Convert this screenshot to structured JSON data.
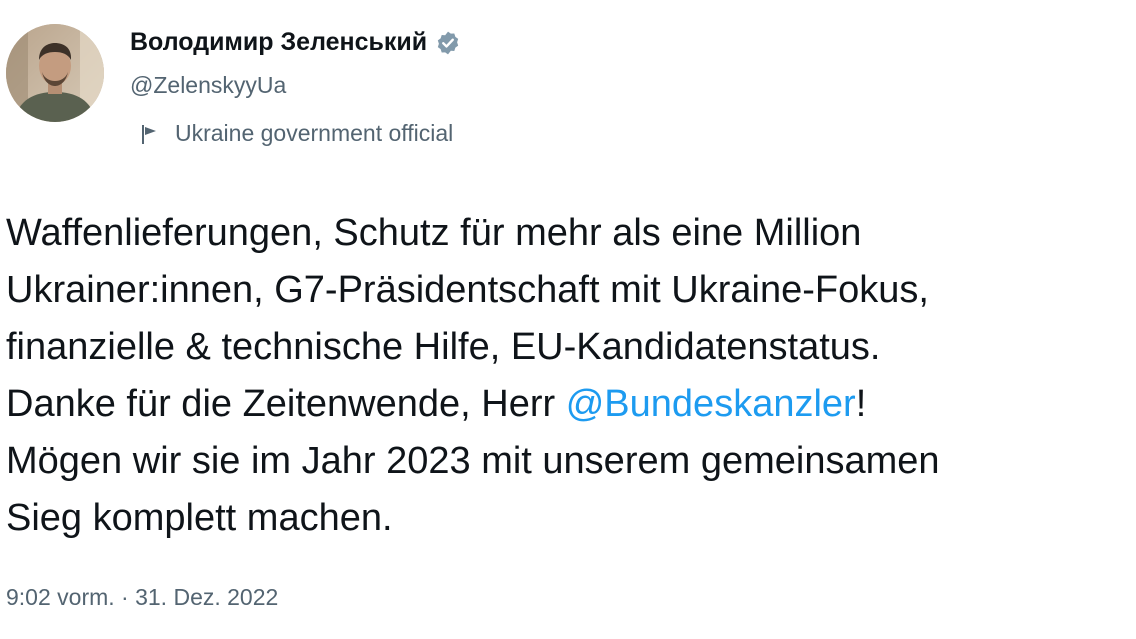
{
  "author": {
    "display_name": "Володимир Зеленський",
    "handle": "@ZelenskyyUa",
    "verified": true,
    "label": "Ukraine government official",
    "avatar_icon": "profile-photo",
    "verified_color": "#829aab"
  },
  "tweet": {
    "line1": "Waffenlieferungen, Schutz für mehr als eine Million",
    "line2": "Ukrainer:innen, G7-Präsidentschaft mit Ukraine-Fokus,",
    "line3": "finanzielle & technische Hilfe, EU-Kandidatenstatus.",
    "line4_before": "Danke für die Zeitenwende, Herr ",
    "line4_mention": "@Bundeskanzler",
    "line4_after": "!",
    "line5": "Mögen wir sie im Jahr 2023 mit unserem gemeinsamen",
    "line6": "Sieg komplett machen.",
    "mention_color": "#1d9bf0"
  },
  "meta": {
    "timestamp": "9:02 vorm. · 31. Dez. 2022"
  }
}
